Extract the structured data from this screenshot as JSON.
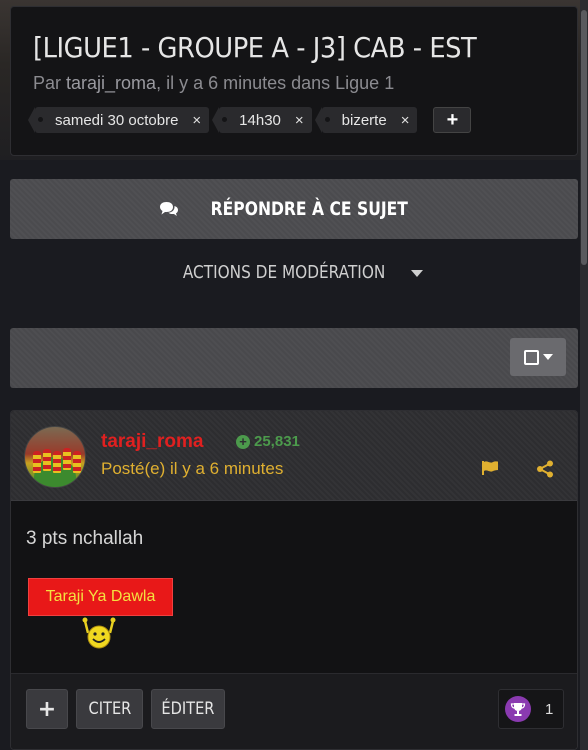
{
  "topic": {
    "title": "[LIGUE1 - GROUPE A - J3] CAB - EST",
    "meta_prefix": "Par ",
    "author": "taraji_roma",
    "meta_suffix": ", il y a 6 minutes dans Ligue 1",
    "tags": [
      {
        "label": "samedi 30 octobre",
        "remove": "×"
      },
      {
        "label": "14h30",
        "remove": "×"
      },
      {
        "label": "bizerte",
        "remove": "×"
      }
    ],
    "add_tag_label": "+"
  },
  "reply_button": {
    "label": "RÉPONDRE À CE SUJET",
    "icon": "comments-icon"
  },
  "moderation": {
    "label": "ACTIONS DE MODÉRATION"
  },
  "post": {
    "author": "taraji_roma",
    "reputation": "25,831",
    "posted": "Posté(e) il y a 6 minutes",
    "body": "3 pts nchallah",
    "signature_text": "Taraji Ya Dawla",
    "buttons": {
      "add": "+",
      "quote": "CITER",
      "edit": "ÉDITER"
    },
    "reaction_count": "1"
  },
  "colors": {
    "author": "#e02020",
    "reputation": "#4c9a4c",
    "posted_time": "#e0b030",
    "reaction": "#8a3ab0"
  }
}
